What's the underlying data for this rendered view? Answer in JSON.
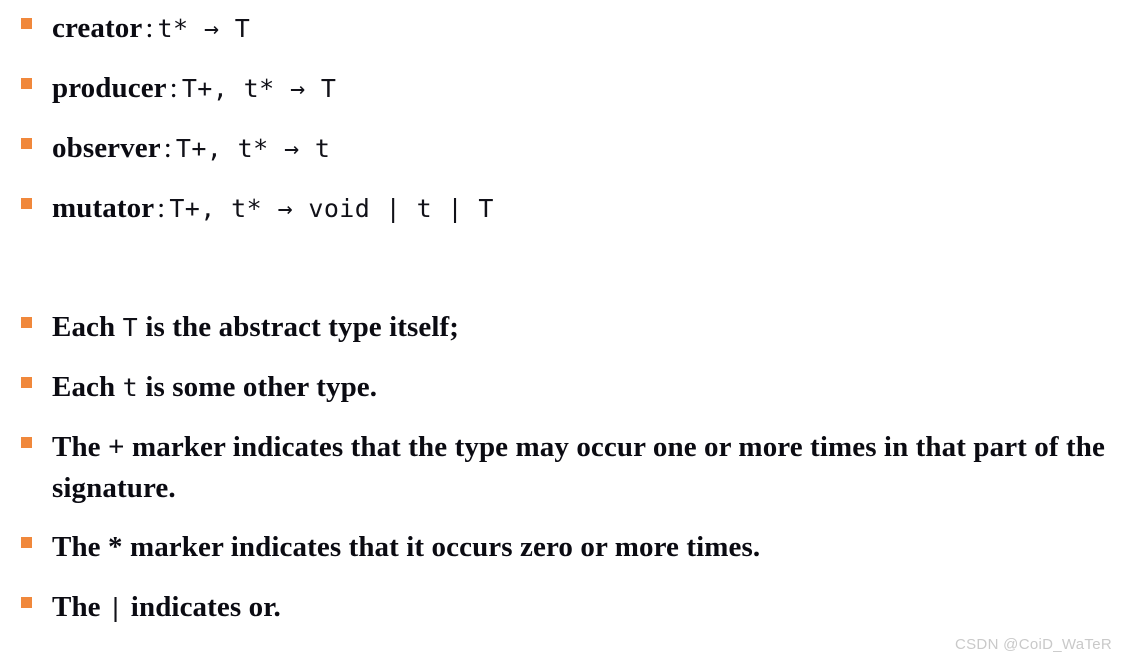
{
  "slide": {
    "background_color": "#ffffff",
    "bullet_color": "#f0883c",
    "text_color": "#0b0b12"
  },
  "signatures": [
    {
      "label": "creator",
      "sep": ":",
      "code": "t* → T"
    },
    {
      "label": "producer",
      "sep": ":",
      "code": "T+, t* → T"
    },
    {
      "label": "observer",
      "sep": ":",
      "code": "T+, t* → t"
    },
    {
      "label": "mutator",
      "sep": ":",
      "code": "T+, t* → void | t | T"
    }
  ],
  "notes": [
    {
      "pre": "Each ",
      "code": "T",
      "post": " is the abstract type itself;"
    },
    {
      "pre": "Each ",
      "code": "t",
      "post": " is some other type."
    },
    {
      "pre": "",
      "code": "",
      "post": "The + marker indicates that the type may occur one or more times in that part of the signature."
    },
    {
      "pre": "",
      "code": "",
      "post": "The * marker indicates that it occurs zero or more times."
    },
    {
      "pre": "The ",
      "code": "|",
      "post": " indicates or."
    }
  ],
  "watermark": {
    "text": "CSDN @CoiD_WaTeR"
  }
}
